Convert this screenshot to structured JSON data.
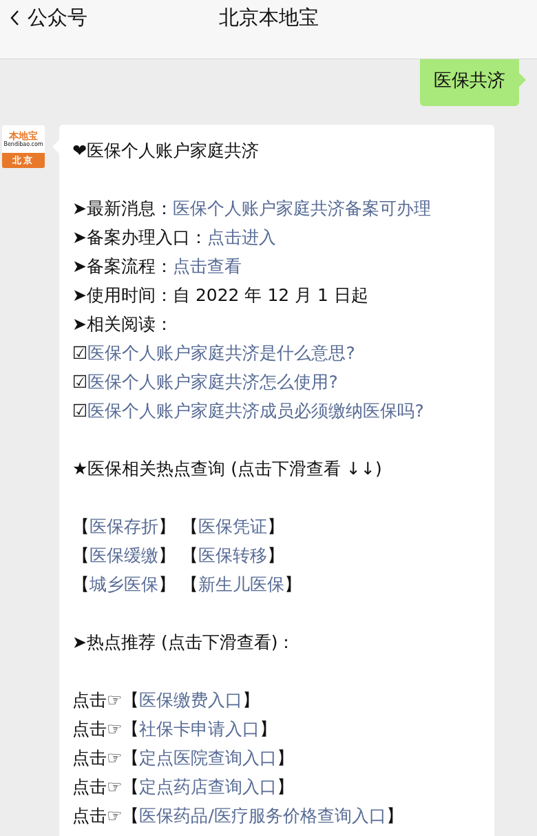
{
  "header": {
    "back_label": "公众号",
    "title": "北京本地宝"
  },
  "sent_message": {
    "text": "医保共济"
  },
  "sender": {
    "logo_title": "本地宝",
    "logo_domain": "Bendibao.com",
    "logo_city": "北京"
  },
  "message": {
    "paragraphs": [
      {
        "lines": [
          {
            "segments": [
              {
                "kind": "text",
                "text": "❤医保个人账户家庭共济"
              }
            ]
          }
        ]
      },
      {
        "lines": [
          {
            "segments": [
              {
                "kind": "text",
                "text": "➤最新消息："
              },
              {
                "kind": "link",
                "text": "医保个人账户家庭共济备案可办理"
              }
            ]
          },
          {
            "segments": [
              {
                "kind": "text",
                "text": "➤备案办理入口："
              },
              {
                "kind": "link",
                "text": "点击进入"
              }
            ]
          },
          {
            "segments": [
              {
                "kind": "text",
                "text": "➤备案流程："
              },
              {
                "kind": "link",
                "text": "点击查看"
              }
            ]
          },
          {
            "segments": [
              {
                "kind": "text",
                "text": "➤使用时间：自 2022 年 12 月 1 日起"
              }
            ]
          },
          {
            "segments": [
              {
                "kind": "text",
                "text": "➤相关阅读："
              }
            ]
          },
          {
            "segments": [
              {
                "kind": "text",
                "text": "☑"
              },
              {
                "kind": "link",
                "text": "医保个人账户家庭共济是什么意思?"
              }
            ]
          },
          {
            "segments": [
              {
                "kind": "text",
                "text": "☑"
              },
              {
                "kind": "link",
                "text": "医保个人账户家庭共济怎么使用?"
              }
            ]
          },
          {
            "segments": [
              {
                "kind": "text",
                "text": "☑"
              },
              {
                "kind": "link",
                "text": "医保个人账户家庭共济成员必须缴纳医保吗?"
              }
            ]
          }
        ]
      },
      {
        "lines": [
          {
            "segments": [
              {
                "kind": "text",
                "text": "★医保相关热点查询 (点击下滑查看 ↓↓)"
              }
            ]
          }
        ]
      },
      {
        "lines": [
          {
            "segments": [
              {
                "kind": "text",
                "text": " 【"
              },
              {
                "kind": "link",
                "text": "医保存折"
              },
              {
                "kind": "text",
                "text": "】 【"
              },
              {
                "kind": "link",
                "text": "医保凭证"
              },
              {
                "kind": "text",
                "text": "】"
              }
            ]
          },
          {
            "segments": [
              {
                "kind": "text",
                "text": " 【"
              },
              {
                "kind": "link",
                "text": "医保缓缴"
              },
              {
                "kind": "text",
                "text": "】 【"
              },
              {
                "kind": "link",
                "text": "医保转移"
              },
              {
                "kind": "text",
                "text": "】"
              }
            ]
          },
          {
            "segments": [
              {
                "kind": "text",
                "text": " 【"
              },
              {
                "kind": "link",
                "text": "城乡医保"
              },
              {
                "kind": "text",
                "text": "】 【"
              },
              {
                "kind": "link",
                "text": "新生儿医保"
              },
              {
                "kind": "text",
                "text": "】"
              }
            ]
          }
        ]
      },
      {
        "lines": [
          {
            "segments": [
              {
                "kind": "text",
                "text": "➤热点推荐 (点击下滑查看)："
              }
            ]
          }
        ]
      },
      {
        "lines": [
          {
            "segments": [
              {
                "kind": "text",
                "text": "点击☞【"
              },
              {
                "kind": "link",
                "text": "医保缴费入口"
              },
              {
                "kind": "text",
                "text": "】"
              }
            ]
          },
          {
            "segments": [
              {
                "kind": "text",
                "text": "点击☞【"
              },
              {
                "kind": "link",
                "text": "社保卡申请入口"
              },
              {
                "kind": "text",
                "text": "】"
              }
            ]
          },
          {
            "segments": [
              {
                "kind": "text",
                "text": "点击☞【"
              },
              {
                "kind": "link",
                "text": "定点医院查询入口"
              },
              {
                "kind": "text",
                "text": "】"
              }
            ]
          },
          {
            "segments": [
              {
                "kind": "text",
                "text": "点击☞【"
              },
              {
                "kind": "link",
                "text": "定点药店查询入口"
              },
              {
                "kind": "text",
                "text": "】"
              }
            ]
          },
          {
            "segments": [
              {
                "kind": "text",
                "text": "点击☞【"
              },
              {
                "kind": "link",
                "text": "医保药品/医疗服务价格查询入口"
              },
              {
                "kind": "text",
                "text": "】"
              }
            ]
          }
        ]
      }
    ]
  }
}
